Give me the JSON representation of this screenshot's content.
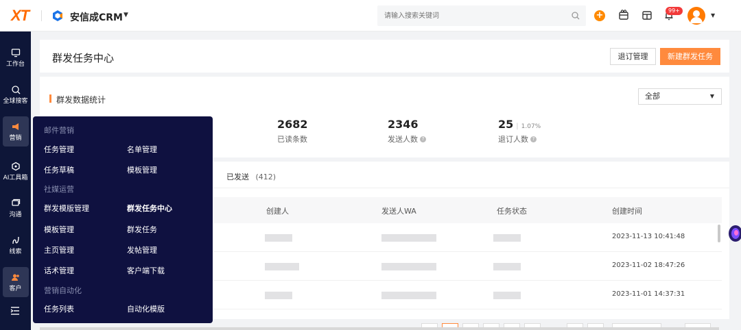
{
  "topbar": {
    "logo": "XT",
    "brand_name": "安信成CRM",
    "search_placeholder": "请输入搜索关键词",
    "notification_badge": "99+"
  },
  "sidebar": {
    "items": [
      {
        "label": "工作台",
        "icon": "monitor-icon"
      },
      {
        "label": "全球搜客",
        "icon": "globe-search-icon"
      },
      {
        "label": "营销",
        "icon": "megaphone-icon",
        "active": true
      },
      {
        "label": "AI工具箱",
        "icon": "ai-box-icon"
      },
      {
        "label": "沟通",
        "icon": "chat-icon"
      },
      {
        "label": "线索",
        "icon": "lead-icon"
      },
      {
        "label": "客户",
        "icon": "customer-icon",
        "active": true
      }
    ]
  },
  "header": {
    "title": "群发任务中心",
    "unsubscribe_label": "退订管理",
    "new_task_label": "新建群发任务"
  },
  "stats": {
    "title": "群发数据统计",
    "filter_value": "全部",
    "items": [
      {
        "value": "2682",
        "label": "已读条数"
      },
      {
        "value": "2346",
        "label": "发送人数"
      },
      {
        "value": "25",
        "label": "退订人数",
        "percent": "1.07%"
      }
    ]
  },
  "list": {
    "tab_label": "已发送",
    "tab_count": "(412)",
    "columns": [
      "创建人",
      "发送人WA",
      "任务状态",
      "创建时间"
    ],
    "rows": [
      {
        "created_at": "2023-11-13 10:41:48"
      },
      {
        "created_at": "2023-11-02 18:47:26"
      },
      {
        "created_at": "2023-11-01 14:37:31"
      }
    ]
  },
  "menu": {
    "sections": [
      {
        "title": "邮件营销",
        "items": [
          "任务管理",
          "名单管理",
          "任务草稿",
          "模板管理"
        ]
      },
      {
        "title": "社媒运营",
        "items": [
          "群发模版管理",
          "群发任务中心",
          "模板管理",
          "群发任务",
          "主页管理",
          "发帖管理",
          "话术管理",
          "客户端下载"
        ]
      },
      {
        "title": "营销自动化",
        "items": [
          "任务列表",
          "自动化模版"
        ]
      }
    ],
    "current": "群发任务中心"
  },
  "colors": {
    "accent": "#ff8a3d",
    "sidebar_bg": "#0e1638",
    "menu_bg": "#0f1140"
  }
}
